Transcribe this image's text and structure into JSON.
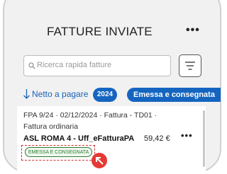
{
  "header": {
    "title": "FATTURE INVIATE",
    "menu_icon": "kebab-menu-icon"
  },
  "search": {
    "placeholder": "Ricerca rapida fatture",
    "icon": "search-icon"
  },
  "filter": {
    "icon": "filter-lines-icon"
  },
  "sort": {
    "label": "Netto a pagare",
    "icon": "arrow-down-icon"
  },
  "chips": {
    "year": "2024",
    "status": "Emessa e consegnata"
  },
  "invoice": {
    "meta_line1": "FPA 9/24 · 02/12/2024 · Fattura - TD01 ·",
    "meta_line2": "Fattura ordinaria",
    "recipient": "ASL ROMA 4 - Uff_eFatturaPA",
    "amount": "59,42 €",
    "status_badge": "EMESSA E CONSEGNATA",
    "menu_icon": "kebab-menu-icon"
  },
  "colors": {
    "accent": "#1565c0",
    "status_green": "#2e7d32",
    "highlight_red": "#d32f2f",
    "pointer_red": "#e53935"
  }
}
